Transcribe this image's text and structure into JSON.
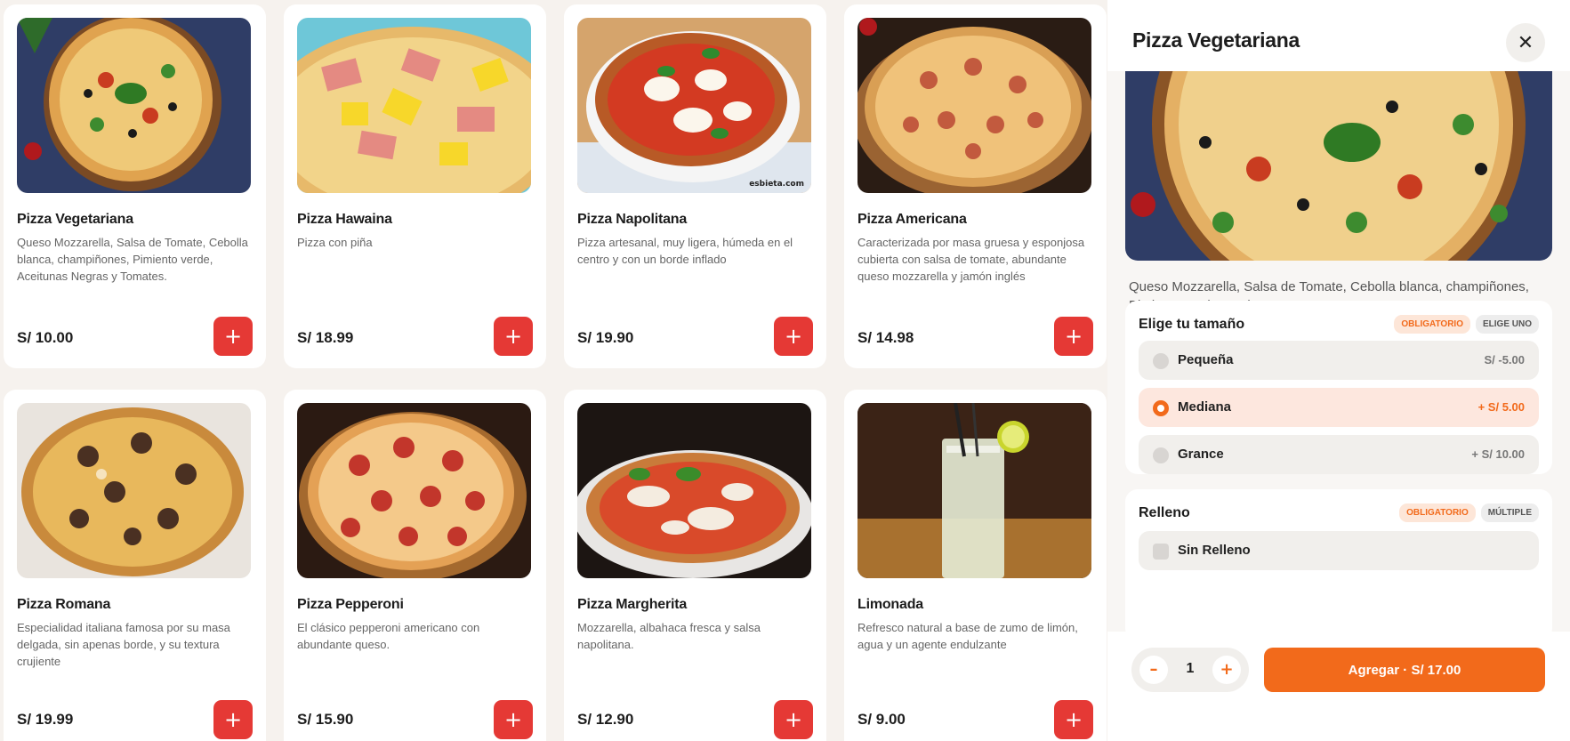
{
  "products": [
    {
      "name": "Pizza Vegetariana",
      "desc": "Queso Mozzarella, Salsa de Tomate, Cebolla blanca, champiñones, Pimiento verde, Aceitunas Negras y Tomates.",
      "price": "S/ 10.00",
      "image": "vegetarian-pizza-image"
    },
    {
      "name": "Pizza Hawaina",
      "desc": "Pizza con piña",
      "price": "S/ 18.99",
      "image": "hawaiian-pizza-image"
    },
    {
      "name": "Pizza Napolitana",
      "desc": "Pizza artesanal, muy ligera, húmeda en el centro y con un borde inflado",
      "price": "S/ 19.90",
      "image": "napolitana-pizza-image",
      "watermark": "esbieta.com"
    },
    {
      "name": "Pizza Americana",
      "desc": "Caracterizada por masa gruesa y esponjosa cubierta con salsa de tomate, abundante queso mozzarella y jamón inglés",
      "price": "S/ 14.98",
      "image": "american-pizza-image"
    },
    {
      "name": "Pizza Romana",
      "desc": "Especialidad italiana famosa por su masa delgada, sin apenas borde, y su textura crujiente",
      "price": "S/ 19.99",
      "image": "romana-pizza-image"
    },
    {
      "name": "Pizza Pepperoni",
      "desc": "El clásico pepperoni americano con abundante queso.",
      "price": "S/ 15.90",
      "image": "pepperoni-pizza-image"
    },
    {
      "name": "Pizza Margherita",
      "desc": "Mozzarella, albahaca fresca y salsa napolitana.",
      "price": "S/ 12.90",
      "image": "margherita-pizza-image"
    },
    {
      "name": "Limonada",
      "desc": "Refresco natural a base de zumo de limón, agua y un agente endulzante",
      "price": "S/ 9.00",
      "image": "lemonade-image"
    }
  ],
  "add_icon": "+",
  "panel": {
    "title": "Pizza Vegetariana",
    "close_icon": "✕",
    "description": "Queso Mozzarella, Salsa de Tomate, Cebolla blanca, champiñones, Pimiento verde, Aceitunas Negras y Tomates.",
    "size_group": {
      "title": "Elige tu tamaño",
      "required_tag": "OBLIGATORIO",
      "type_tag": "ELIGE UNO",
      "options": [
        {
          "label": "Pequeña",
          "price": "S/ -5.00",
          "selected": false
        },
        {
          "label": "Mediana",
          "price": "+ S/ 5.00",
          "selected": true
        },
        {
          "label": "Grance",
          "price": "+ S/ 10.00",
          "selected": false
        }
      ]
    },
    "filling_group": {
      "title": "Relleno",
      "required_tag": "OBLIGATORIO",
      "type_tag": "MÚLTIPLE",
      "options": [
        {
          "label": "Sin Relleno",
          "selected": false
        }
      ]
    },
    "quantity": "1",
    "minus_icon": "–",
    "plus_icon": "+",
    "add_button": "Agregar · S/ 17.00"
  },
  "colors": {
    "accent": "#f26a1b",
    "add_button": "#e53935",
    "background": "#f6f2ee"
  }
}
